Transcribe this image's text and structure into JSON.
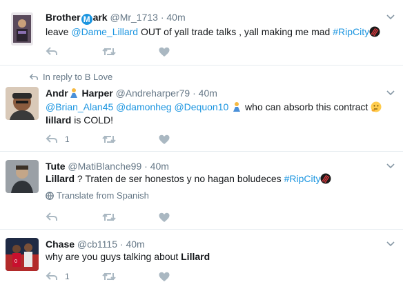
{
  "tweets": [
    {
      "name_part1": "Brother",
      "name_letter": "M",
      "name_part2": "ark",
      "handle": "@Mr_1713",
      "time": "· 40m",
      "text": {
        "t1": "leave ",
        "mention": "@Dame_Lillard",
        "t2": " OUT of yall trade talks , yall making me mad ",
        "hashtag": "#RipCity"
      },
      "reply_count": "",
      "avatar_color": "#5a4a5c"
    },
    {
      "reply_context": "In reply to B Love",
      "name_part1": "Andr",
      "name_part2": " Harper",
      "handle": "@Andreharper79",
      "time": "· 40m",
      "text": {
        "m1": "@Brian_Alan45",
        "m2": "@damonheg",
        "m3": "@Dequon10",
        "t1": " who can absorb this contract ",
        "b1": "lillard",
        "t2": " is COLD!"
      },
      "reply_count": "1",
      "avatar_color": "#6b4e3d"
    },
    {
      "name": "Tute",
      "handle": "@MatiBlanche99",
      "time": "· 40m",
      "text": {
        "b1": "Lillard",
        "t1": " ? Traten de ser honestos y no hagan boludeces ",
        "hashtag": "#RipCity"
      },
      "translate": "Translate from Spanish",
      "reply_count": "",
      "avatar_color": "#7a7f86"
    },
    {
      "name": "Chase",
      "handle": "@cb1115",
      "time": "· 40m",
      "text": {
        "t1": "why are you guys talking about ",
        "b1": "Lillard"
      },
      "reply_count": "1",
      "avatar_color": "#b22a2a"
    }
  ],
  "colors": {
    "link": "#1b95e0",
    "secondary": "#657786",
    "icon": "#aab8c2",
    "divider": "#e6ecf0"
  }
}
